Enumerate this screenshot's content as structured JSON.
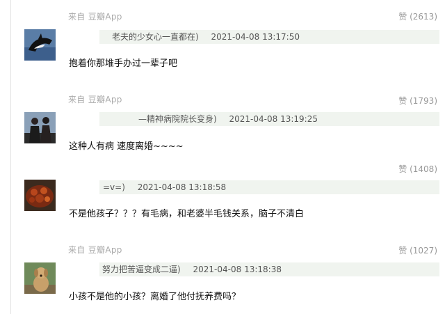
{
  "comments": [
    {
      "source": "来自 豆瓣App",
      "likes": "赞 (2613)",
      "user": "老夫的少女心一直都在)",
      "time": "2021-04-08 13:17:50",
      "text": "抱着你那堆手办过一辈子吧",
      "avatar_icon": "orca-photo-avatar"
    },
    {
      "source": "来自 豆瓣App",
      "likes": "赞 (1793)",
      "user": "—精神病院院长变身)",
      "time": "2021-04-08 13:19:25",
      "text": "这种人有病 速度离婚~~~~",
      "avatar_icon": "couple-photo-avatar"
    },
    {
      "source": "",
      "likes": "赞 (1408)",
      "user": "=v=)",
      "time": "2021-04-08 13:18:58",
      "text": "不是他孩子？？？有毛病，和老婆半毛钱关系，脑子不清白",
      "avatar_icon": "food-photo-avatar"
    },
    {
      "source": "来自 豆瓣App",
      "likes": "赞 (1027)",
      "user": "努力把苦逼变成二逼)",
      "time": "2021-04-08 13:18:38",
      "text": "小孩不是他的小孩？离婚了他付抚养费吗？",
      "avatar_icon": "dog-photo-avatar"
    }
  ]
}
